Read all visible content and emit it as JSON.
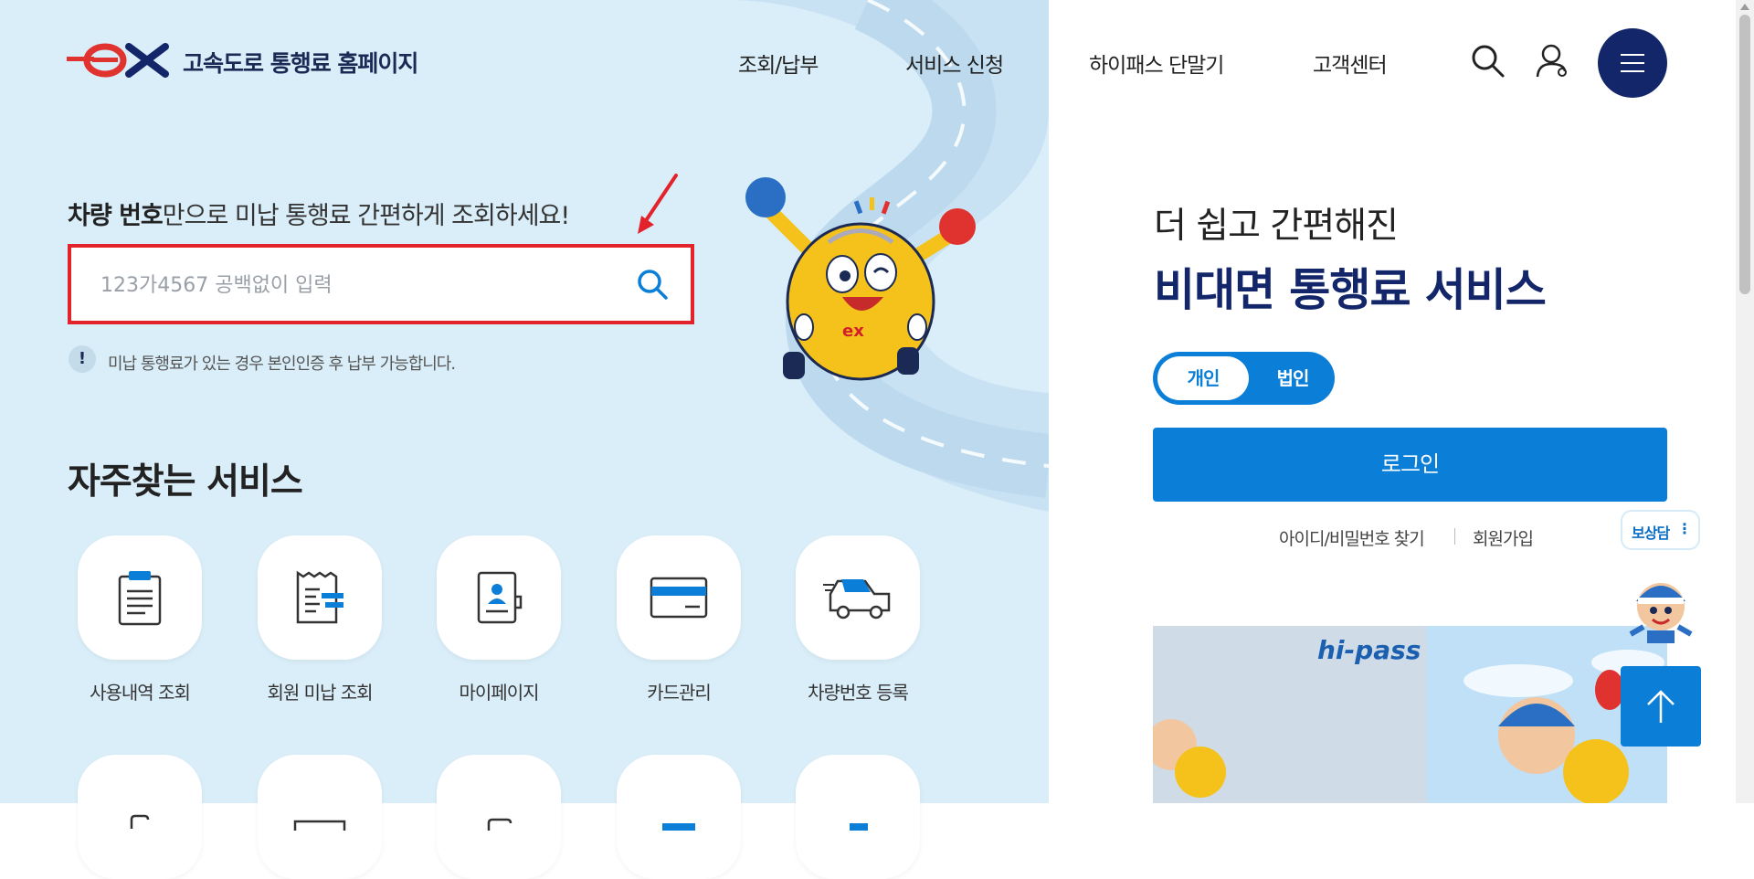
{
  "header": {
    "logo_text": "ex",
    "site_title": "고속도로 통행료 홈페이지",
    "nav": [
      "조회/납부",
      "서비스 신청",
      "하이패스 단말기",
      "고객센터"
    ],
    "icons": [
      "search-icon",
      "user-icon",
      "menu-icon"
    ]
  },
  "search": {
    "headline_bold": "차량 번호",
    "headline_rest": "만으로 미납 통행료 간편하게 조회하세요!",
    "placeholder": "123가4567 공백없이 입력",
    "notice_mark": "!",
    "notice": "미납 통행료가 있는 경우 본인인증 후 납부 가능합니다."
  },
  "mascot": {
    "badge_text": "ex"
  },
  "services": {
    "title": "자주찾는 서비스",
    "items": [
      {
        "label": "사용내역 조회",
        "icon": "clipboard-icon"
      },
      {
        "label": "회원 미납 조회",
        "icon": "receipt-icon"
      },
      {
        "label": "마이페이지",
        "icon": "profile-card-icon"
      },
      {
        "label": "카드관리",
        "icon": "credit-card-icon"
      },
      {
        "label": "차량번호 등록",
        "icon": "car-icon"
      }
    ]
  },
  "right": {
    "sub": "더 쉽고 간편해진",
    "main": "비대면 통행료 서비스",
    "toggle": {
      "on": "개인",
      "off": "법인"
    },
    "login": "로그인",
    "find": "아이디/비밀번호 찾기",
    "join": "회원가입"
  },
  "banner": {
    "brand": "hi-pass"
  },
  "chatbot": {
    "label": "보상담",
    "dots": "⋮"
  },
  "colors": {
    "primary": "#0b7fd8",
    "navy": "#14266a",
    "highlight": "#e3232b",
    "bg": "#daeef9"
  }
}
